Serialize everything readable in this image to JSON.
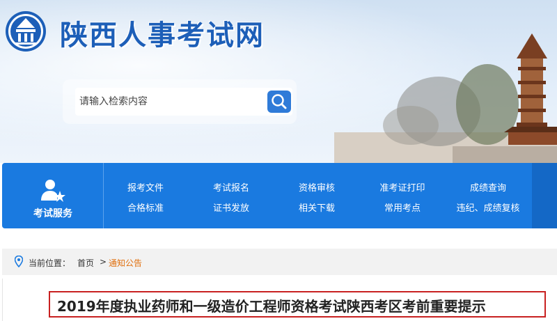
{
  "site": {
    "title": "陕西人事考试网"
  },
  "search": {
    "placeholder": "请输入检索内容"
  },
  "nav": {
    "service_label": "考试服务",
    "links": [
      "报考文件",
      "考试报名",
      "资格审核",
      "准考证打印",
      "成绩查询",
      "合格标准",
      "证书发放",
      "相关下载",
      "常用考点",
      "违纪、成绩复核"
    ]
  },
  "breadcrumb": {
    "label": "当前位置：",
    "home": "首页",
    "separator": ">",
    "current": "通知公告"
  },
  "article": {
    "title": "2019年度执业药师和一级造价工程师资格考试陕西考区考前重要提示"
  },
  "colors": {
    "primary_blue": "#1a7ae0",
    "title_blue": "#1d5fb8",
    "crumb_orange": "#e0700f",
    "highlight_red": "#c82020"
  }
}
